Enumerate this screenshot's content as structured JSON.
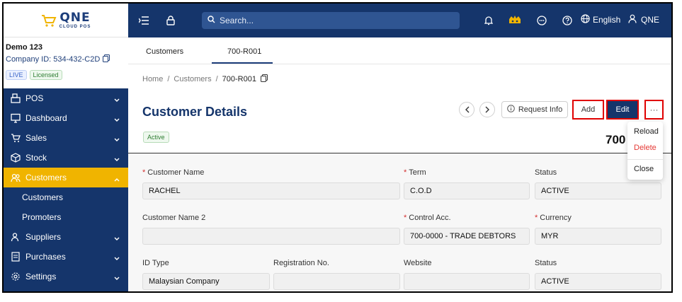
{
  "brand": {
    "logo_main": "QNE",
    "logo_sub": "CLOUD POS"
  },
  "company": {
    "name": "Demo 123",
    "id_text": "Company ID: 534-432-C2D",
    "badge_live": "LIVE",
    "badge_licensed": "Licensed"
  },
  "sidebar": {
    "items": [
      {
        "label": "POS"
      },
      {
        "label": "Dashboard"
      },
      {
        "label": "Sales"
      },
      {
        "label": "Stock"
      },
      {
        "label": "Customers"
      },
      {
        "label": "Customers"
      },
      {
        "label": "Promoters"
      },
      {
        "label": "Suppliers"
      },
      {
        "label": "Purchases"
      },
      {
        "label": "Settings"
      }
    ]
  },
  "topbar": {
    "search_placeholder": "Search...",
    "language": "English",
    "user": "QNE"
  },
  "tabs": [
    {
      "label": "Customers"
    },
    {
      "label": "700-R001"
    }
  ],
  "breadcrumb": {
    "home": "Home",
    "sep": "/",
    "customers": "Customers",
    "current": "700-R001"
  },
  "page": {
    "title": "Customer Details",
    "status": "Active",
    "code_partial": "700"
  },
  "actions": {
    "request_info": "Request Info",
    "add": "Add",
    "edit": "Edit",
    "more": "···"
  },
  "menu": {
    "reload": "Reload",
    "delete": "Delete",
    "close": "Close"
  },
  "form": {
    "customer_name_label": "Customer Name",
    "customer_name_value": "RACHEL",
    "term_label": "Term",
    "term_value": "C.O.D",
    "status_label": "Status",
    "status_value": "ACTIVE",
    "customer_name2_label": "Customer Name 2",
    "customer_name2_value": "",
    "control_acc_label": "Control Acc.",
    "control_acc_value": "700-0000 - TRADE DEBTORS",
    "currency_label": "Currency",
    "currency_value": "MYR",
    "id_type_label": "ID Type",
    "id_type_value": "Malaysian Company",
    "reg_no_label": "Registration No.",
    "reg_no_value": "",
    "website_label": "Website",
    "website_value": "",
    "status2_label": "Status",
    "status2_value": "ACTIVE"
  },
  "colors": {
    "navy": "#15356b",
    "accent": "#f0b400",
    "danger": "#e53935",
    "highlight_border": "#e00000"
  }
}
